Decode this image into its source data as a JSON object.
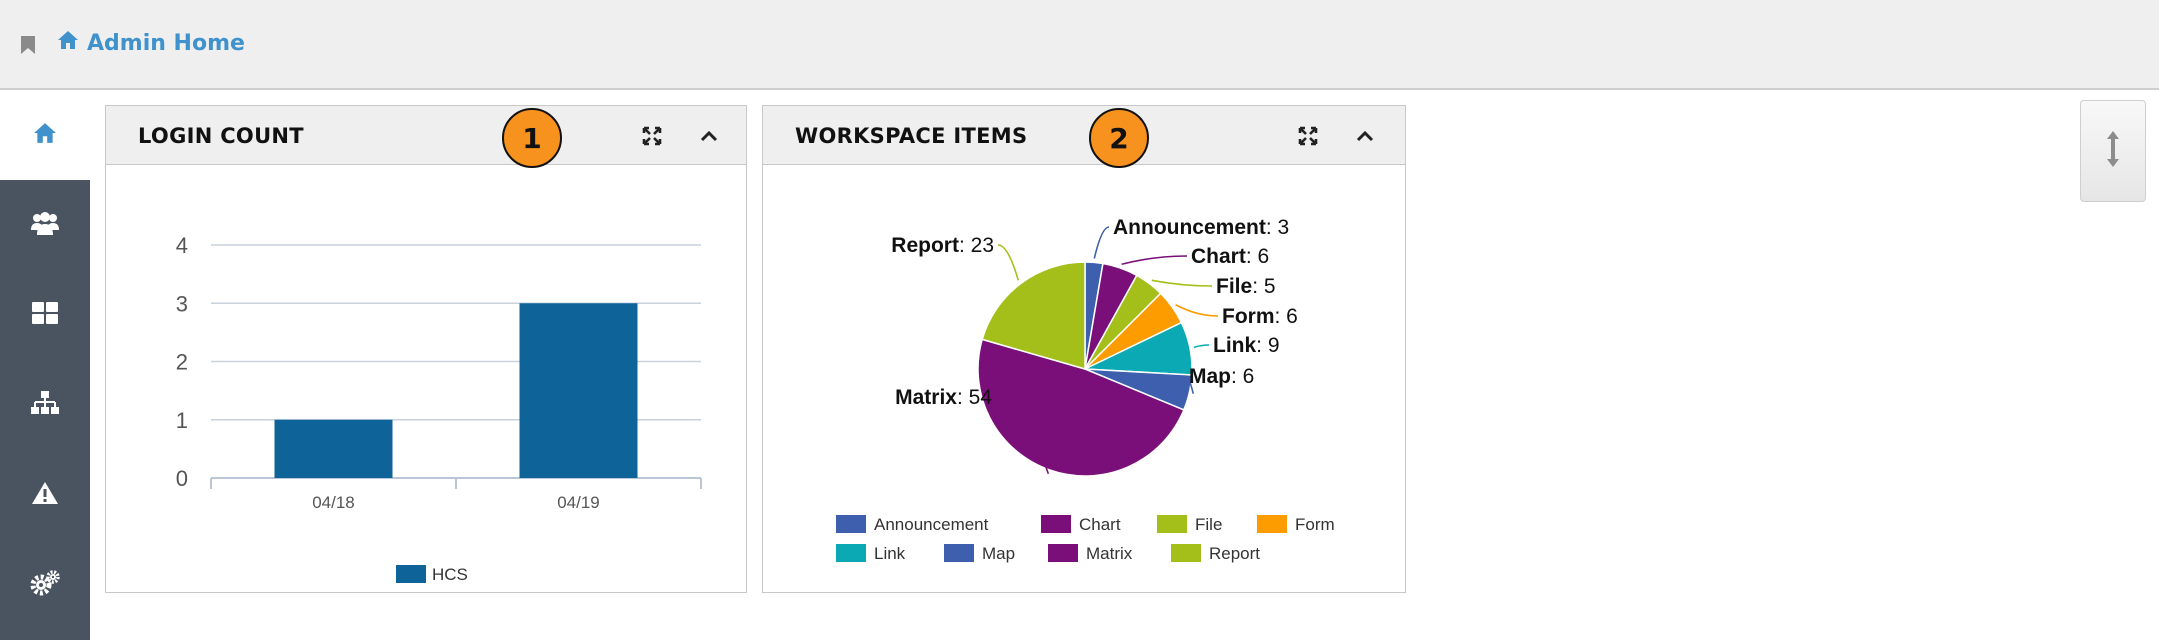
{
  "header": {
    "breadcrumb_icon": "home-icon",
    "breadcrumb_label": "Admin Home",
    "bookmark_icon": "bookmark-icon"
  },
  "sidebar": {
    "items": [
      {
        "icon": "home-icon",
        "active": true
      },
      {
        "icon": "users-icon"
      },
      {
        "icon": "dashboard-grid-icon"
      },
      {
        "icon": "sitemap-icon"
      },
      {
        "icon": "warning-icon"
      },
      {
        "icon": "gears-icon"
      }
    ]
  },
  "panels": [
    {
      "title": "LOGIN COUNT",
      "badge": "1",
      "expand_icon": "expand-icon",
      "collapse_icon": "chevron-up-icon"
    },
    {
      "title": "WORKSPACE ITEMS",
      "badge": "2",
      "expand_icon": "expand-icon",
      "collapse_icon": "chevron-up-icon"
    }
  ],
  "resize_icon": "vertical-resize-icon",
  "colors": {
    "accent": "#3f92cc",
    "sidebar": "#4a5360",
    "badge": "#f7921e",
    "bar": "#0e6499"
  },
  "chart_data": [
    {
      "type": "bar",
      "categories": [
        "04/18",
        "04/19"
      ],
      "series": [
        {
          "name": "HCS",
          "values": [
            1,
            3
          ]
        }
      ],
      "ylim": [
        0,
        4
      ],
      "yticks": [
        "0",
        "1",
        "2",
        "3",
        "4"
      ],
      "grid": true,
      "legend": "bottom"
    },
    {
      "type": "pie",
      "slices": [
        {
          "label": "Announcement",
          "value": 3,
          "color": "#3d5fad"
        },
        {
          "label": "Chart",
          "value": 6,
          "color": "#7a0f7a"
        },
        {
          "label": "File",
          "value": 5,
          "color": "#a5bf1a"
        },
        {
          "label": "Form",
          "value": 6,
          "color": "#fd9c00"
        },
        {
          "label": "Link",
          "value": 9,
          "color": "#0aa9b3"
        },
        {
          "label": "Map",
          "value": 6,
          "color": "#3d5fad"
        },
        {
          "label": "Matrix",
          "value": 54,
          "color": "#7a0f7a"
        },
        {
          "label": "Report",
          "value": 23,
          "color": "#a5bf1a"
        }
      ],
      "legend": "bottom"
    }
  ]
}
